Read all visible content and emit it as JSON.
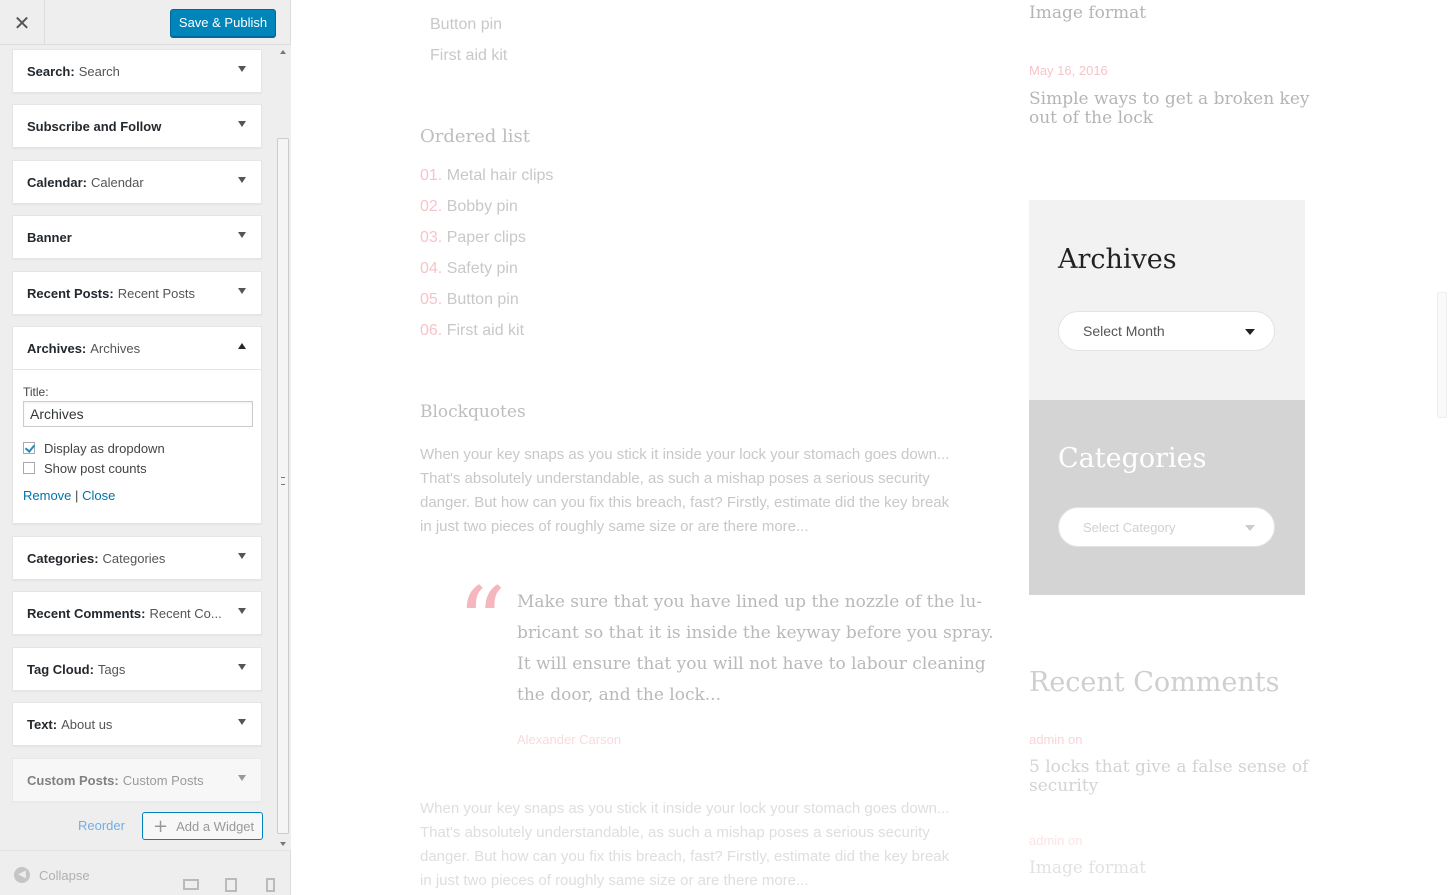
{
  "customizer": {
    "close_glyph": "✕",
    "publish_label": "Save & Publish",
    "widgets": [
      {
        "name": "Search:",
        "title": "Search"
      },
      {
        "name": "Subscribe and Follow",
        "title": ""
      },
      {
        "name": "Calendar:",
        "title": "Calendar"
      },
      {
        "name": "Banner",
        "title": ""
      },
      {
        "name": "Recent Posts:",
        "title": "Recent Posts"
      },
      {
        "name": "Archives:",
        "title": "Archives"
      },
      {
        "name": "Categories:",
        "title": "Categories"
      },
      {
        "name": "Recent Comments:",
        "title": "Recent Co..."
      },
      {
        "name": "Tag Cloud:",
        "title": "Tags"
      },
      {
        "name": "Text:",
        "title": "About us"
      },
      {
        "name": "Custom Posts:",
        "title": "Custom Posts"
      }
    ],
    "archives_form": {
      "title_label": "Title:",
      "title_value": "Archives",
      "dropdown_label": "Display as dropdown",
      "dropdown_checked": true,
      "counts_label": "Show post counts",
      "counts_checked": false,
      "remove_label": "Remove",
      "separator": "|",
      "close_label": "Close"
    },
    "reorder_label": "Reorder",
    "add_widget_label": "Add a Widget",
    "collapse_label": "Collapse",
    "icons": [
      "close-icon",
      "arrow-down-icon",
      "arrow-up-icon",
      "plus-icon",
      "collapse-icon",
      "desktop-icon",
      "tablet-icon",
      "mobile-icon"
    ]
  },
  "preview": {
    "top_list": [
      "Button pin",
      "First aid kit"
    ],
    "ordered_heading": "Ordered list",
    "ordered_items": [
      {
        "num": "01.",
        "text": "Metal hair clips"
      },
      {
        "num": "02.",
        "text": "Bobby pin"
      },
      {
        "num": "03.",
        "text": "Paper clips"
      },
      {
        "num": "04.",
        "text": "Safety pin"
      },
      {
        "num": "05.",
        "text": "Button pin"
      },
      {
        "num": "06.",
        "text": "First aid kit"
      }
    ],
    "blockquotes_heading": "Blockquotes",
    "paragraph_lines": [
      "When your key snaps as you stick it inside your lock your stomach goes down...",
      "That's absolutely understandable, as such a mishap poses a serious security",
      "danger. But how can you fix this breach, fast? Firstly, estimate did the key break",
      "in just two pieces of roughly same size or are there more..."
    ],
    "quote_lines": [
      "Make sure that you have lined up the nozzle of the lu-",
      "bricant so that it is inside the keyway before you spray.",
      "It will ensure that you will not have to labour cleaning",
      "the door, and the lock..."
    ],
    "quote_author": "Alexander Carson",
    "right": {
      "post1_title": "Image format",
      "post2_date": "May 16, 2016",
      "post2_title_lines": [
        "Simple ways to get a broken key",
        "out of the lock"
      ],
      "archives_heading": "Archives",
      "archives_select": "Select Month",
      "categories_heading": "Categories",
      "categories_select": "Select Category",
      "recent_comments_heading": "Recent Comments",
      "comment1_meta": "admin on",
      "comment1_title_lines": [
        "5 locks that give a false sense of",
        "security"
      ],
      "comment2_meta": "admin on",
      "comment2_title": "Image format"
    },
    "accent_color": "#f6c4c9"
  }
}
